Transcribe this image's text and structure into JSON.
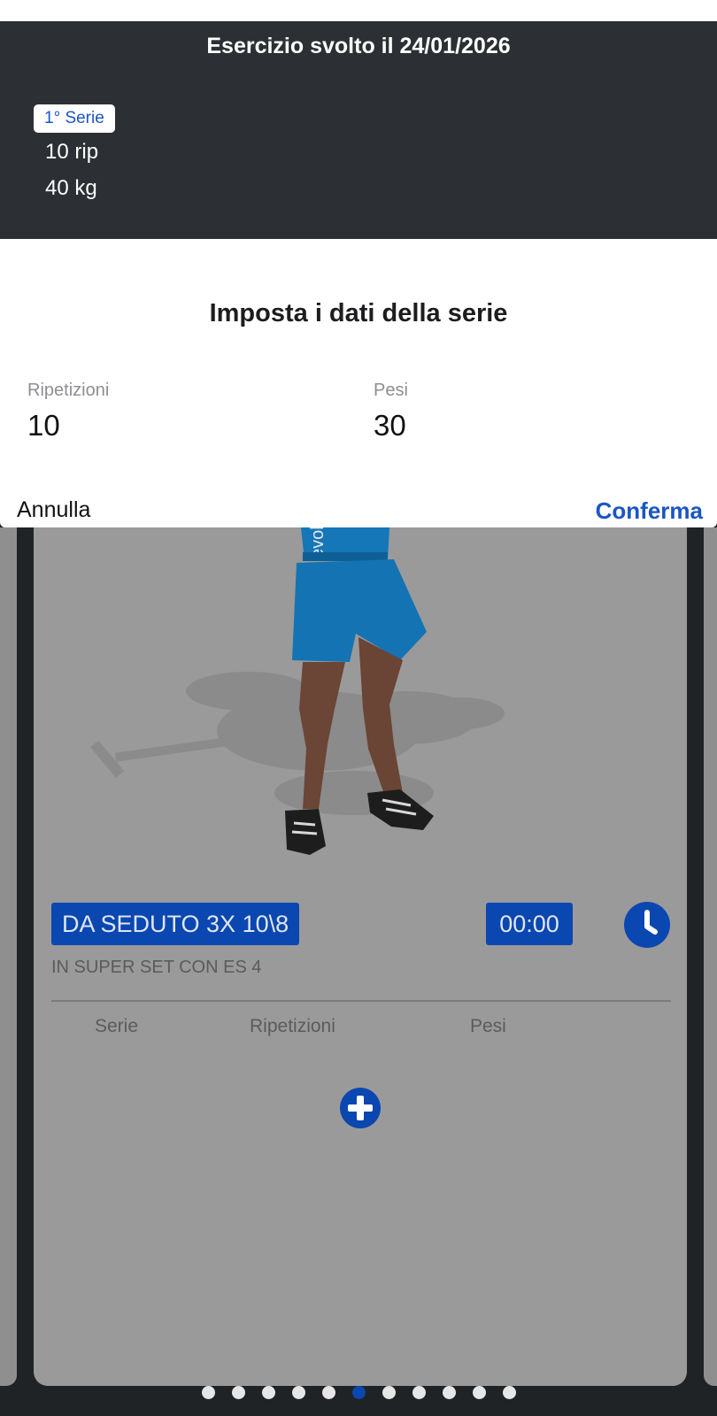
{
  "history": {
    "title": "Esercizio svolto il 24/01/2026",
    "series": [
      {
        "badge": "1° Serie",
        "reps": "10 rip",
        "weight": "40 kg"
      }
    ]
  },
  "dialog": {
    "title": "Imposta i dati della serie",
    "reps_label": "Ripetizioni",
    "reps_value": "10",
    "weight_label": "Pesi",
    "weight_value": "30",
    "cancel_label": "Annulla",
    "confirm_label": "Conferma"
  },
  "exercise": {
    "title": "DA SEDUTO 3X 10\\8",
    "timer": "00:00",
    "note": "IN SUPER SET CON ES 4",
    "shirt_text": "evolu",
    "columns": [
      "Serie",
      "Ripetizioni",
      "Pesi"
    ]
  },
  "pagination": {
    "total": 11,
    "active_index": 5
  },
  "colors": {
    "accent": "#1a56c4",
    "badge_blue": "#0b47b0",
    "panel_dark": "#2c3034",
    "card_gray": "#9a9a9a"
  },
  "icons": [
    "clock-icon",
    "plus-circle-icon"
  ]
}
